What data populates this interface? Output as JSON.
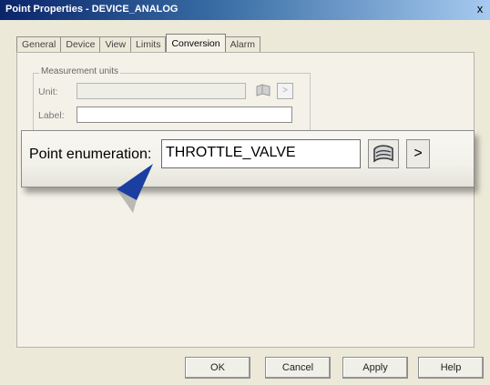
{
  "window": {
    "title": "Point Properties - DEVICE_ANALOG",
    "close_label": "x"
  },
  "tabs": [
    {
      "label": "General"
    },
    {
      "label": "Device"
    },
    {
      "label": "View"
    },
    {
      "label": "Limits"
    },
    {
      "label": "Conversion"
    },
    {
      "label": "Alarm"
    }
  ],
  "active_tab": "Conversion",
  "measurement": {
    "group_label": "Measurement units",
    "unit_label": "Unit:",
    "unit_value": "",
    "label_label": "Label:",
    "label_value": ""
  },
  "enumeration": {
    "label": "Point enumeration:",
    "value": "THROTTLE_VALVE",
    "browse_icon": "book-icon",
    "more_icon": "chevron-right-icon",
    "more_label": ">"
  },
  "footer": {
    "ok_label": "OK",
    "cancel_label": "Cancel",
    "apply_label": "Apply",
    "help_label": "Help"
  },
  "colors": {
    "titlebar_start": "#0a246a",
    "titlebar_end": "#a6caf0",
    "pointer": "#1b3fa0"
  }
}
